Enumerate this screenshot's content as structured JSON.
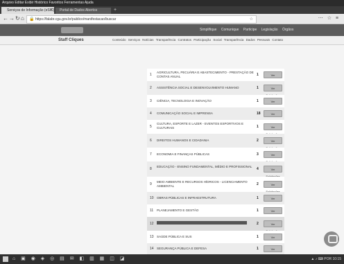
{
  "os": {
    "menu": "Arquivo Editar Exibir Histórico Favoritos Ferramentas Ajuda"
  },
  "browser": {
    "active_tab": "Serviços de Informação (eSIC)",
    "inactive_tab": "Portal de Dados Abertos",
    "new_tab": "+",
    "url": "https://falabr.cgu.gov.br/publico/manifestacao/buscar",
    "nav_back": "←",
    "nav_forward": "→",
    "nav_reload": "↻",
    "nav_home": "⌂",
    "nav_right": "⋯ ☆ ≡"
  },
  "site": {
    "gov_links": "Simplifique Comunique Participe Legislação Órgãos",
    "title": "Staff Cliques",
    "nav": "Conteúdo Serviços Notícias Transparência Contratos Participação Social Transparência Dados Pessoais Contato"
  },
  "rows": [
    {
      "idx": "1",
      "title": "AGRICULTURA, PECUÁRIA E ABASTECIMENTO - PRESTAÇÃO DE CONTAS ANUAL",
      "count": "1",
      "button": "Ver Solicitações"
    },
    {
      "idx": "2",
      "title": "ASSISTÊNCIA SOCIAL E DESENVOLVIMENTO HUMANO",
      "count": "1",
      "button": "Ver Solicitações"
    },
    {
      "idx": "3",
      "title": "CIÊNCIA, TECNOLOGIA E INOVAÇÃO",
      "count": "1",
      "button": "Ver Solicitações"
    },
    {
      "idx": "4",
      "title": "COMUNICAÇÃO SOCIAL E IMPRENSA",
      "count": "18",
      "button": "Ver Solicitações"
    },
    {
      "idx": "5",
      "title": "CULTURA, ESPORTE E LAZER - EVENTOS ESPORTIVOS E CULTURAIS",
      "count": "1",
      "button": "Ver Solicitações"
    },
    {
      "idx": "6",
      "title": "DIREITOS HUMANOS E CIDADANIA",
      "count": "2",
      "button": "Ver Solicitações"
    },
    {
      "idx": "7",
      "title": "ECONOMIA E FINANÇAS PÚBLICAS",
      "count": "3",
      "button": "Ver Solicitações"
    },
    {
      "idx": "8",
      "title": "EDUCAÇÃO - ENSINO FUNDAMENTAL, MÉDIO E PROFISSIONAL",
      "count": "4",
      "button": "Ver Solicitações"
    },
    {
      "idx": "9",
      "title": "MEIO AMBIENTE E RECURSOS HÍDRICOS - LICENCIAMENTO AMBIENTAL",
      "count": "2",
      "button": "Ver Solicitações"
    },
    {
      "idx": "10",
      "title": "OBRAS PÚBLICAS E INFRAESTRUTURA",
      "count": "1",
      "button": "Ver Solicitações"
    },
    {
      "idx": "11",
      "title": "PLANEJAMENTO E GESTÃO",
      "count": "1",
      "button": "Ver Solicitações"
    },
    {
      "idx": "12",
      "title": "",
      "count": "2",
      "button": "Ver Solicitações",
      "redacted": true
    },
    {
      "idx": "13",
      "title": "SAÚDE PÚBLICA E SUS",
      "count": "1",
      "button": "Ver Solicitações"
    },
    {
      "idx": "14",
      "title": "SEGURANÇA PÚBLICA E DEFESA",
      "count": "1",
      "button": "Ver Solicitações"
    }
  ],
  "taskbar": {
    "apps": "⌂ ▣ ◉ ◈ ◎ ▤ ✉ ◧ ▥ ▦ ◫ ◪",
    "tray": "▲ ♪ ⌨ POR 10:15"
  }
}
